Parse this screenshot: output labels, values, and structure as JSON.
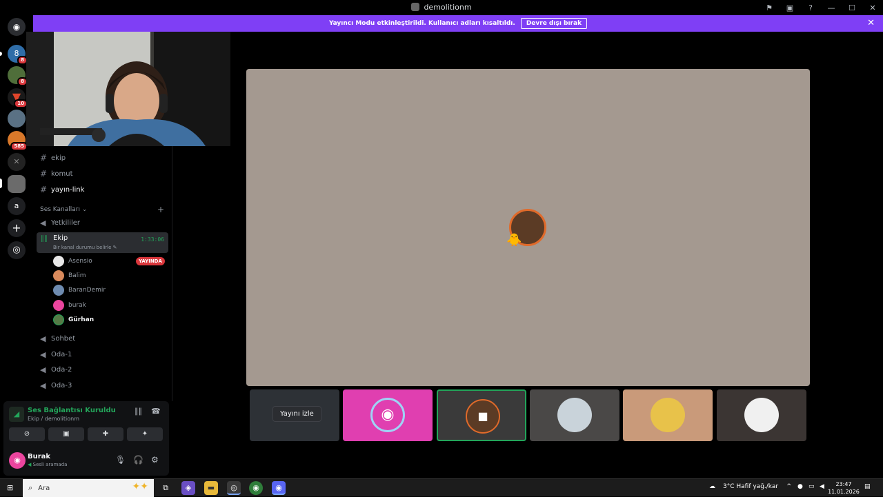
{
  "window": {
    "title": "demolitionm",
    "controls": [
      "⚑",
      "▣",
      "?",
      "—",
      "☐",
      "✕"
    ]
  },
  "banner": {
    "text": "Yayıncı Modu etkinleştirildi. Kullanıcı adları kısaltıldı.",
    "button": "Devre dışı bırak",
    "close": "✕"
  },
  "guilds": [
    {
      "name": "home",
      "glyph": "",
      "badge": ""
    },
    {
      "name": "guild-1",
      "glyph": "8",
      "badge": "8"
    },
    {
      "name": "guild-2",
      "glyph": "",
      "badge": "8"
    },
    {
      "name": "guild-3",
      "glyph": "",
      "badge": "10"
    },
    {
      "name": "guild-4",
      "glyph": "",
      "badge": ""
    },
    {
      "name": "guild-5",
      "glyph": "",
      "badge": "585"
    },
    {
      "name": "guild-6",
      "glyph": "✕",
      "badge": ""
    },
    {
      "name": "guild-7",
      "glyph": "",
      "badge": ""
    },
    {
      "name": "guild-8",
      "glyph": "a",
      "badge": ""
    },
    {
      "name": "add-server",
      "glyph": "+",
      "badge": ""
    },
    {
      "name": "discover",
      "glyph": "◎",
      "badge": ""
    }
  ],
  "channels": {
    "text": [
      {
        "name": "ekip",
        "active": false
      },
      {
        "name": "komut",
        "active": false
      },
      {
        "name": "yayın-link",
        "active": true
      }
    ],
    "voice_category": "Ses Kanalları",
    "voice": [
      {
        "name": "Yetkililer"
      },
      {
        "name": "Sohbet"
      },
      {
        "name": "Oda-1"
      },
      {
        "name": "Oda-2"
      },
      {
        "name": "Oda-3"
      }
    ],
    "current": {
      "name": "Ekip",
      "status": "Bir kanal durumu belirle",
      "timer": "1:33:06"
    },
    "members": [
      {
        "name": "Asensio",
        "live": "YAYINDA",
        "color": "#e8e8e8"
      },
      {
        "name": "Balim",
        "live": "",
        "color": "#d98a5c"
      },
      {
        "name": "BaranDemir",
        "live": "",
        "color": "#6e8bb0"
      },
      {
        "name": "burak",
        "live": "",
        "color": "#eb459e"
      },
      {
        "name": "Gürhan",
        "live": "",
        "color": "#557a46"
      }
    ]
  },
  "voice_panel": {
    "title": "Ses Bağlantısı Kuruldu",
    "subtitle": "Ekip / demolitionm",
    "user": {
      "name": "Burak",
      "status": "Sesli aramada"
    }
  },
  "stage": {
    "watch_label": "Yayını izle"
  },
  "tiles": [
    {
      "name": "watch",
      "bg": "#2d3136",
      "av": ""
    },
    {
      "name": "discord",
      "bg": "#e03fb0",
      "av": "#e03fb0"
    },
    {
      "name": "camera",
      "bg": "#3a3a3a",
      "av": "#5b3b25"
    },
    {
      "name": "user-4",
      "bg": "#4a4847",
      "av": "#c9d3da"
    },
    {
      "name": "user-5",
      "bg": "#c99a7a",
      "av": "#e8c24a"
    },
    {
      "name": "user-6",
      "bg": "#3b3533",
      "av": "#f0f0f0"
    }
  ],
  "taskbar": {
    "search": "Ara",
    "weather": "3°C  Hafif yağ./kar",
    "time": "23:47",
    "date": "11.01.2026"
  }
}
